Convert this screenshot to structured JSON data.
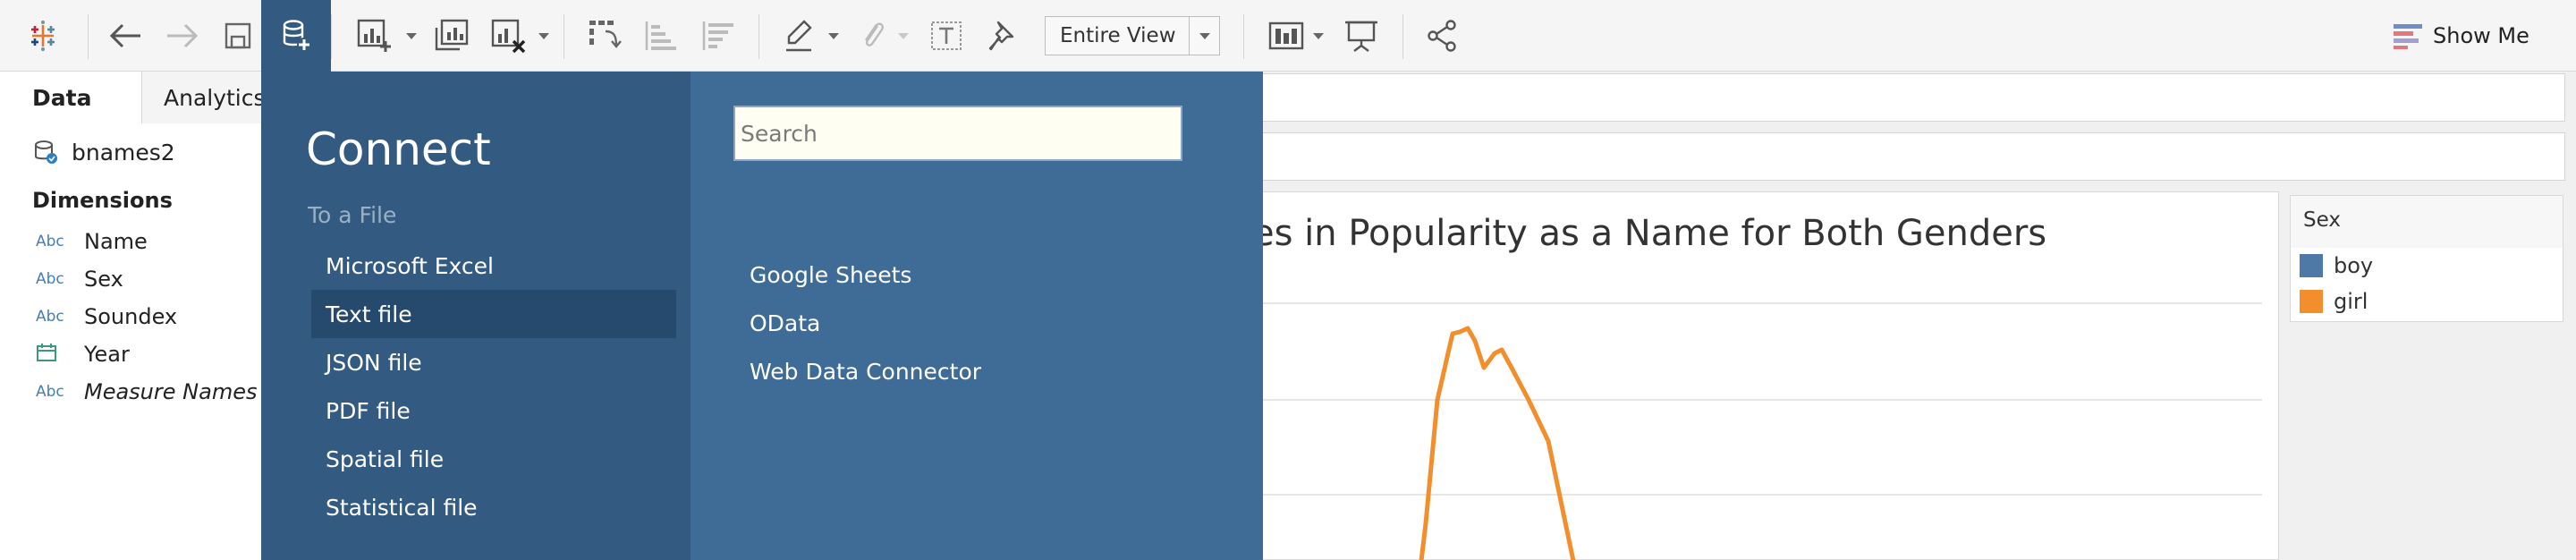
{
  "toolbar": {
    "view_select": "Entire View",
    "show_me": "Show Me"
  },
  "left_pane": {
    "tabs": [
      "Data",
      "Analytics"
    ],
    "datasource": "bnames2",
    "dimensions_header": "Dimensions",
    "fields": [
      {
        "type": "Abc",
        "name": "Name"
      },
      {
        "type": "Abc",
        "name": "Sex"
      },
      {
        "type": "Abc",
        "name": "Soundex"
      },
      {
        "type": "date",
        "name": "Year"
      },
      {
        "type": "Abc",
        "name": "Measure Names"
      }
    ]
  },
  "viz": {
    "title_fragment": "es in Popularity as a Name for Both Genders",
    "line_color": "#f28e2b"
  },
  "legend": {
    "title": "Sex",
    "items": [
      {
        "label": "boy",
        "color": "#4e79a7"
      },
      {
        "label": "girl",
        "color": "#f28e2b"
      }
    ]
  },
  "connect": {
    "title": "Connect",
    "section": "To a File",
    "files": [
      "Microsoft Excel",
      "Text file",
      "JSON file",
      "PDF file",
      "Spatial file",
      "Statistical file"
    ],
    "selected_index": 1,
    "search_placeholder": "Search",
    "servers": [
      "Google Sheets",
      "OData",
      "Web Data Connector"
    ]
  }
}
